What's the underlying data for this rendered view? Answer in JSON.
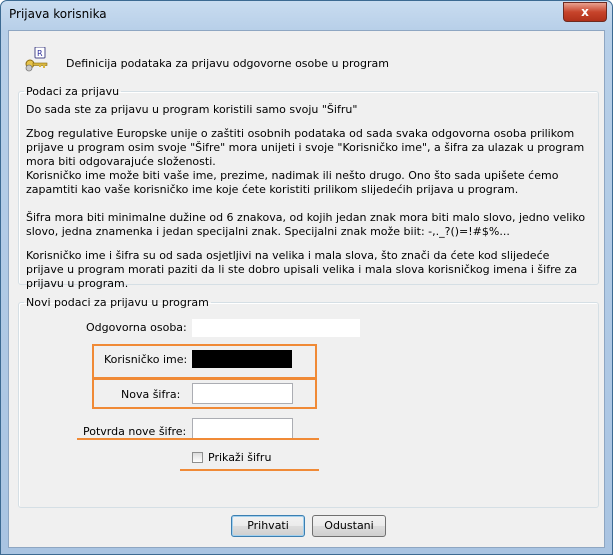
{
  "window": {
    "title": "Prijava korisnika",
    "close_glyph": "x"
  },
  "header": {
    "icon": "keys-icon",
    "text": "Definicija podataka za prijavu odgovorne osobe u program"
  },
  "info_group": {
    "legend": "Podaci za prijavu",
    "paragraphs": [
      "Do sada ste za prijavu u program koristili samo svoju \"Šifru\"",
      "Zbog regulative Europske unije o zaštiti osobnih podataka od sada svaka odgovorna osoba prilikom prijave u program osim svoje \"Šifre\" mora unijeti i svoje \"Korisničko ime\", a šifra za ulazak u program mora biti odgovarajuće složenosti.",
      "Korisničko ime može biti vaše ime, prezime, nadimak ili nešto drugo. Ono što sada upišete ćemo zapamtiti kao vaše korisničko ime koje ćete koristiti prilikom slijedećih prijava u program.",
      "Šifra  mora biti minimalne dužine od 6 znakova, od kojih jedan znak mora biti malo slovo, jedno veliko slovo, jedna znamenka i jedan  specijalni znak. Specijalni znak može biit: -,._?()=!#$%...",
      "Korisničko ime i šifra su od sada osjetljivi na velika i mala slova, što znači da ćete kod slijedeće prijave u program morati paziti da li ste dobro upisali velika i mala slova korisničkog imena i šifre za prijavu u program."
    ]
  },
  "new_data_group": {
    "legend": "Novi podaci za prijavu u program",
    "responsible_person_label": "Odgovorna osoba:",
    "responsible_person_value": "",
    "username_label": "Korisničko ime:",
    "username_value": "",
    "new_password_label": "Nova šifra:",
    "new_password_value": "",
    "confirm_password_label": "Potvrda nove šifre:",
    "confirm_password_value": "",
    "show_password_label": "Prikaži šifru",
    "show_password_checked": false
  },
  "buttons": {
    "confirm": "Prihvati",
    "cancel": "Odustani"
  },
  "colors": {
    "highlight": "#f08a36",
    "title_bar": "#b7cfe8",
    "close_button": "#c7442b"
  }
}
